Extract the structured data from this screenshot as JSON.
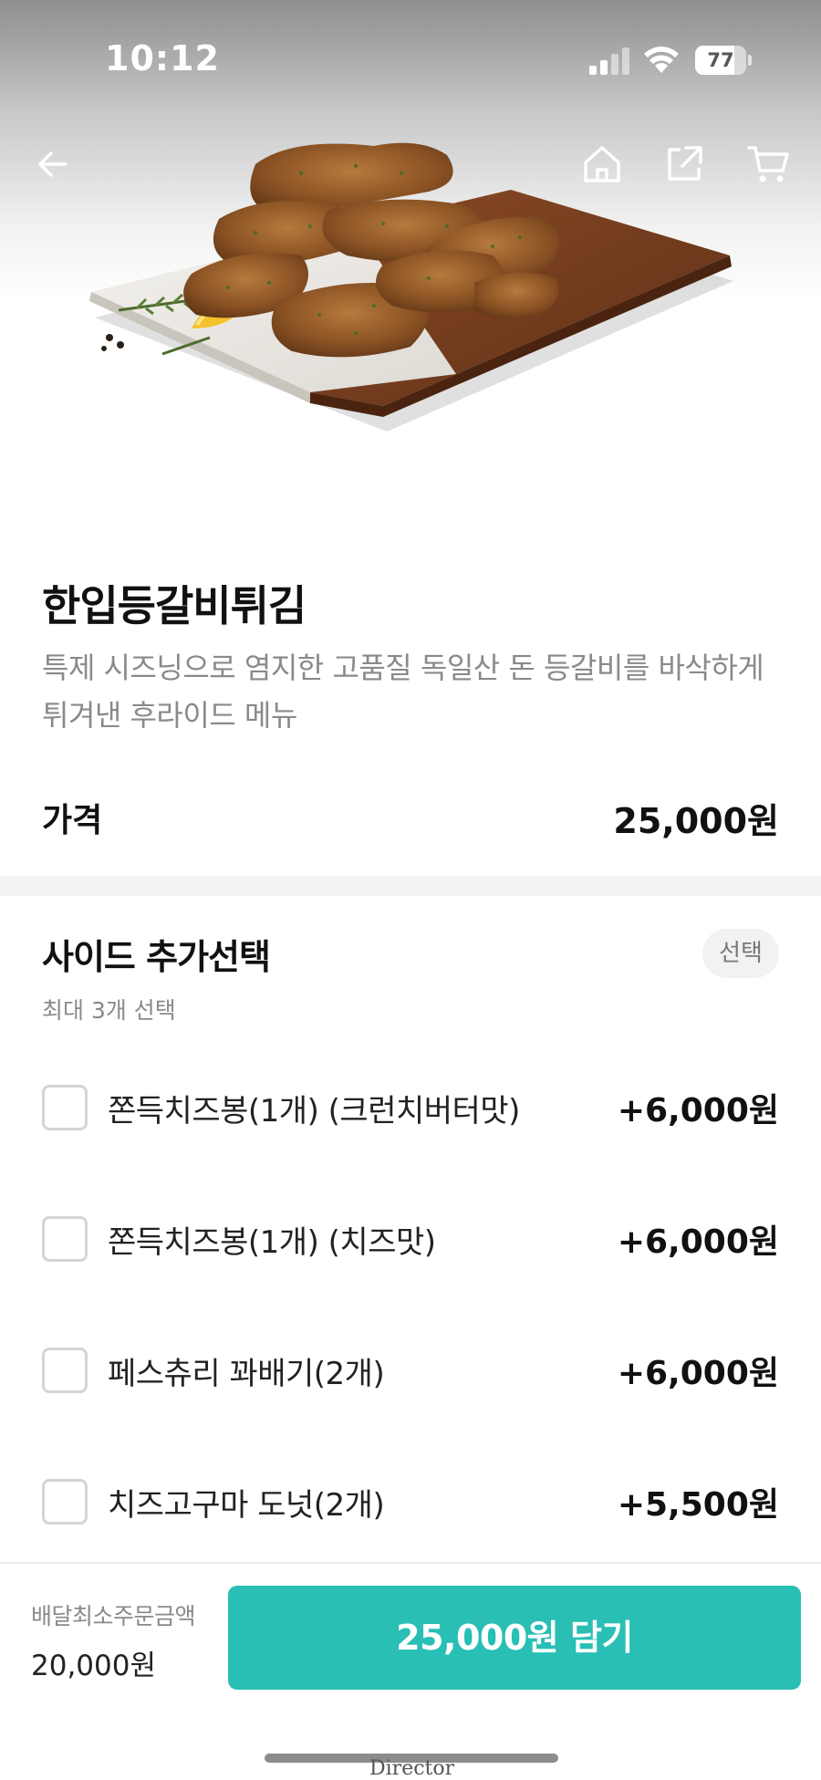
{
  "status_bar": {
    "time": "10:12",
    "battery_level": "77",
    "battery_fraction": 0.77
  },
  "nav": {
    "back_icon": "arrow-left-icon",
    "home_icon": "home-icon",
    "share_icon": "share-icon",
    "cart_icon": "cart-icon"
  },
  "product": {
    "image": "fried-pork-ribs-photo",
    "name": "한입등갈비튀김",
    "description": "특제 시즈닝으로 염지한 고품질 독일산 돈 등갈비를 바삭하게 튀겨낸 후라이드 메뉴",
    "price_label": "가격",
    "price": "25,000원"
  },
  "options": {
    "title": "사이드 추가선택",
    "badge": "선택",
    "subtitle": "최대 3개 선택",
    "items": [
      {
        "name": "쫀득치즈봉(1개) (크런치버터맛)",
        "price": "+6,000원",
        "checked": false
      },
      {
        "name": "쫀득치즈봉(1개) (치즈맛)",
        "price": "+6,000원",
        "checked": false
      },
      {
        "name": "페스츄리 꽈배기(2개)",
        "price": "+6,000원",
        "checked": false
      },
      {
        "name": "치즈고구마 도넛(2개)",
        "price": "+5,500원",
        "checked": false
      }
    ]
  },
  "bottom_bar": {
    "min_order_label": "배달최소주문금액",
    "min_order_value": "20,000원",
    "add_button_label": "25,000원 담기",
    "overlay_text": "Director"
  },
  "colors": {
    "accent": "#29bfb5",
    "divider": "#f2f3f5",
    "muted_text": "#8a8a8a"
  }
}
